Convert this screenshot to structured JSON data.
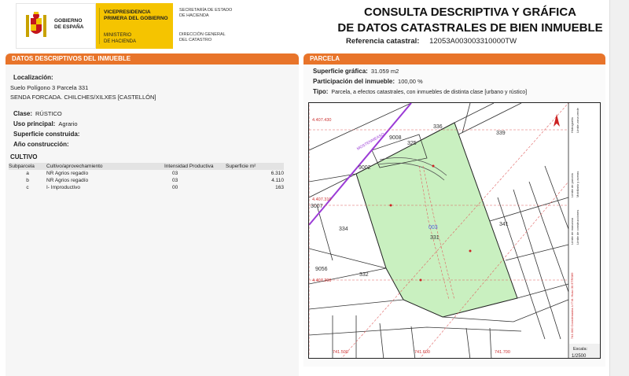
{
  "header": {
    "gov_name": [
      "GOBIERNO",
      "DE ESPAÑA"
    ],
    "vice": [
      "VICEPRESIDENCIA",
      "PRIMERA DEL GOBIERNO"
    ],
    "ministerio": [
      "MINISTERIO",
      "DE HACIENDA"
    ],
    "secretaria": [
      "SECRETARÍA DE ESTADO",
      "DE HACIENDA"
    ],
    "direccion": [
      "DIRECCIÓN GENERAL",
      "DEL CATASTRO"
    ],
    "title_line1": "CONSULTA DESCRIPTIVA Y GRÁFICA",
    "title_line2": "DE DATOS CATASTRALES DE BIEN INMUEBLE",
    "ref_label": "Referencia catastral:",
    "ref_value": "12053A003003310000TW"
  },
  "left": {
    "heading": "DATOS DESCRIPTIVOS DEL INMUEBLE",
    "localizacion_label": "Localización:",
    "localizacion_line1": "Suelo Polígono 3 Parcela 331",
    "localizacion_line2": "SENDA FORCADA. CHILCHES/XILXES [CASTELLÓN]",
    "clase_label": "Clase:",
    "clase_value": "RÚSTICO",
    "uso_label": "Uso principal:",
    "uso_value": "Agrario",
    "superficie_label": "Superficie construida:",
    "anio_label": "Año construcción:",
    "cultivo_label": "CULTIVO",
    "table_headers": [
      "Subparcela",
      "Cultivo/aprovechamiento",
      "Intensidad Productiva",
      "Superficie m²"
    ],
    "table_rows": [
      [
        "a",
        "NR Agrios regadío",
        "03",
        "6.310"
      ],
      [
        "b",
        "NR Agrios regadío",
        "03",
        "4.110"
      ],
      [
        "c",
        "I- Improductivo",
        "00",
        "163"
      ]
    ]
  },
  "right": {
    "heading": "PARCELA",
    "sup_label": "Superficie gráfica:",
    "sup_value": "31.059 m2",
    "part_label": "Participación del inmueble:",
    "part_value": "100,00 %",
    "tipo_label": "Tipo:",
    "tipo_value": "Parcela, a efectos catastrales, con inmuebles de distinta clase [urbano y rústico]"
  },
  "map": {
    "parcel_fill": "#c9f0c0",
    "labels": {
      "p336": "336",
      "p339": "339",
      "p9008": "9008",
      "p325": "325",
      "p9002": "9002",
      "p3007": "3007",
      "p334": "334",
      "p331": "331",
      "p341": "341",
      "p9056": "9056",
      "p332": "332",
      "p003": "003",
      "road": "MOSTENMEASO",
      "coord_top": "4.407.430",
      "coord_mid": "4.407.310",
      "coord_low": "4.407.200",
      "coord_b1": "741.500",
      "coord_b2": "741.600",
      "coord_b3": "741.700"
    },
    "legend": [
      "Límite de parcela",
      "Mobiliario y aceras",
      "Límite de manzana",
      "Límite zona verde",
      "Hidrografía",
      "Límite de construcciones"
    ],
    "legend_side": "741.000 Coordenadas U.T.M. Huso 30 ETRS89",
    "escala_label": "Escala:",
    "escala_value": "1/2500"
  }
}
